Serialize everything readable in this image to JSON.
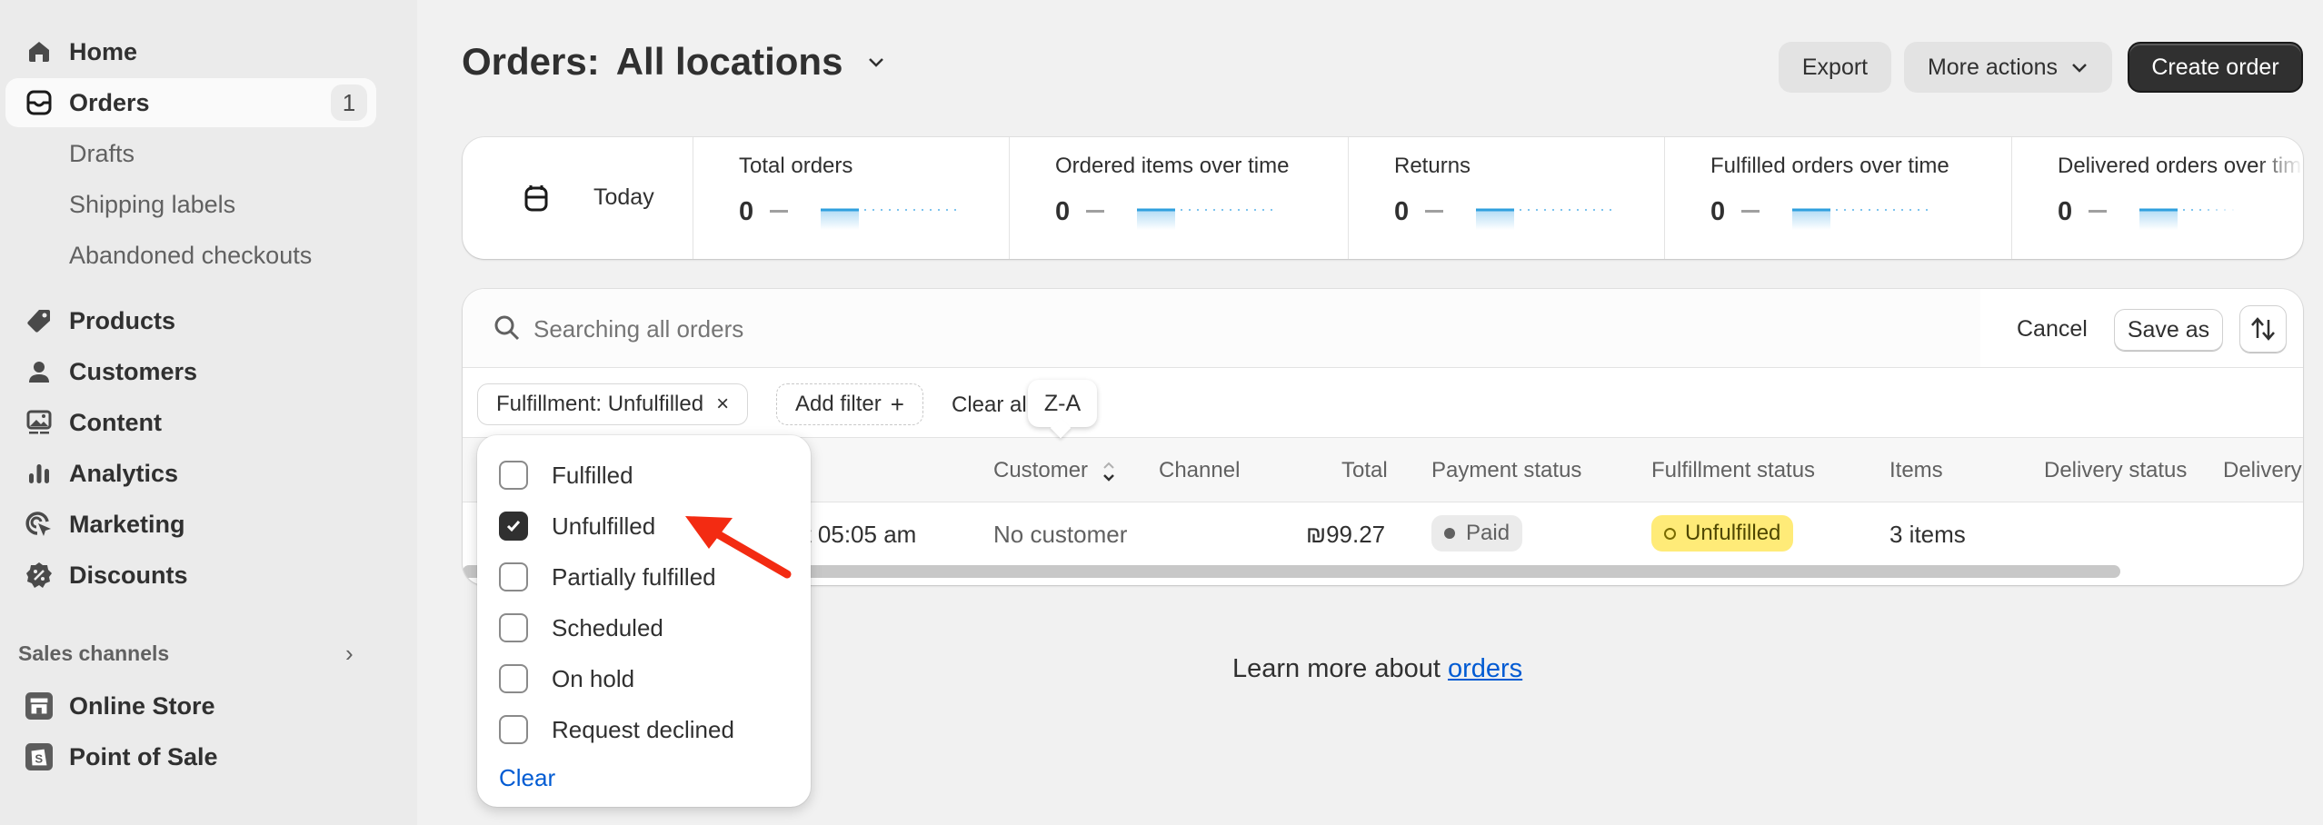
{
  "sidebar": {
    "items": [
      {
        "label": "Home",
        "icon": "home-icon"
      },
      {
        "label": "Orders",
        "icon": "inbox-icon",
        "badge": "1",
        "active": true
      },
      {
        "label": "Drafts"
      },
      {
        "label": "Shipping labels"
      },
      {
        "label": "Abandoned checkouts"
      },
      {
        "label": "Products",
        "icon": "tag-icon"
      },
      {
        "label": "Customers",
        "icon": "person-icon"
      },
      {
        "label": "Content",
        "icon": "image-icon"
      },
      {
        "label": "Analytics",
        "icon": "bar-chart-icon"
      },
      {
        "label": "Marketing",
        "icon": "target-icon"
      },
      {
        "label": "Discounts",
        "icon": "discount-icon"
      }
    ],
    "sales_channels_label": "Sales channels",
    "channels": [
      {
        "label": "Online Store",
        "icon": "store-icon"
      },
      {
        "label": "Point of Sale",
        "icon": "pos-icon"
      }
    ]
  },
  "header": {
    "title": "Orders:",
    "location": "All locations",
    "export_label": "Export",
    "more_actions_label": "More actions",
    "create_order_label": "Create order"
  },
  "metrics": {
    "date_label": "Today",
    "items": [
      {
        "title": "Total orders",
        "value": "0"
      },
      {
        "title": "Ordered items over time",
        "value": "0"
      },
      {
        "title": "Returns",
        "value": "0"
      },
      {
        "title": "Fulfilled orders over time",
        "value": "0"
      },
      {
        "title": "Delivered orders over time",
        "value": "0"
      }
    ]
  },
  "orders": {
    "search_placeholder": "Searching all orders",
    "cancel_label": "Cancel",
    "save_as_label": "Save as",
    "filter_chip": "Fulfillment: Unfulfilled",
    "add_filter_label": "Add filter",
    "clear_all_label": "Clear all",
    "tooltip": "Z-A",
    "columns": [
      "Customer",
      "Channel",
      "Total",
      "Payment status",
      "Fulfillment status",
      "Items",
      "Delivery status",
      "Delivery method"
    ],
    "rows": [
      {
        "date": "at 05:05 am",
        "customer": "No customer",
        "channel": "",
        "total": "₪99.27",
        "payment_status": "Paid",
        "fulfillment_status": "Unfulfilled",
        "items": "3 items",
        "delivery_status": "",
        "delivery_method": ""
      }
    ]
  },
  "fulfillment_popover": {
    "options": [
      {
        "label": "Fulfilled",
        "checked": false
      },
      {
        "label": "Unfulfilled",
        "checked": true
      },
      {
        "label": "Partially fulfilled",
        "checked": false
      },
      {
        "label": "Scheduled",
        "checked": false
      },
      {
        "label": "On hold",
        "checked": false
      },
      {
        "label": "Request declined",
        "checked": false
      }
    ],
    "clear_label": "Clear"
  },
  "footer": {
    "learn_more_text": "Learn more about ",
    "learn_more_link": "orders"
  },
  "colors": {
    "accent_link": "#005bd3",
    "unfulfilled_badge": "#ffeb78",
    "annotation_arrow": "#f32b12",
    "primary_button": "#303030"
  }
}
